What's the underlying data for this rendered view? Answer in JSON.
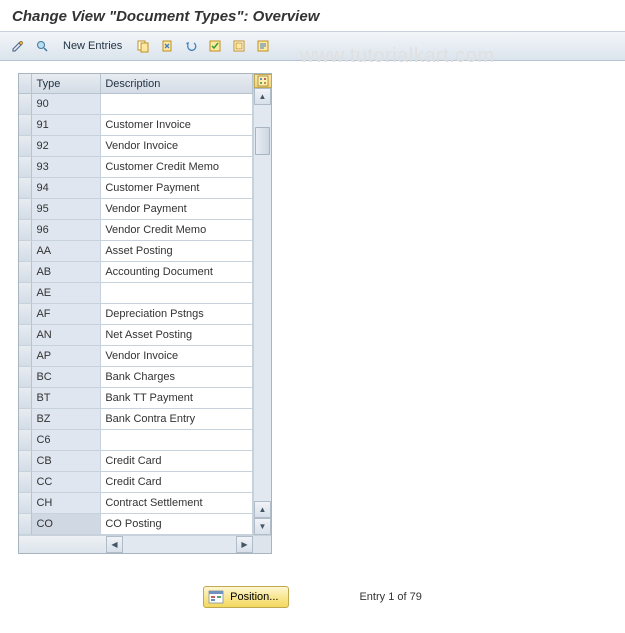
{
  "title": "Change View \"Document Types\": Overview",
  "watermark": "www.tutorialkart.com",
  "toolbar": {
    "new_entries": "New Entries"
  },
  "table": {
    "headers": {
      "type": "Type",
      "description": "Description"
    },
    "rows": [
      {
        "type": "90",
        "desc": ""
      },
      {
        "type": "91",
        "desc": "Customer Invoice"
      },
      {
        "type": "92",
        "desc": "Vendor Invoice"
      },
      {
        "type": "93",
        "desc": "Customer Credit Memo"
      },
      {
        "type": "94",
        "desc": "Customer Payment"
      },
      {
        "type": "95",
        "desc": "Vendor Payment"
      },
      {
        "type": "96",
        "desc": "Vendor Credit Memo"
      },
      {
        "type": "AA",
        "desc": "Asset Posting"
      },
      {
        "type": "AB",
        "desc": "Accounting Document"
      },
      {
        "type": "AE",
        "desc": ""
      },
      {
        "type": "AF",
        "desc": "Depreciation Pstngs"
      },
      {
        "type": "AN",
        "desc": "Net Asset Posting"
      },
      {
        "type": "AP",
        "desc": "Vendor Invoice"
      },
      {
        "type": "BC",
        "desc": "Bank Charges"
      },
      {
        "type": "BT",
        "desc": "Bank TT Payment"
      },
      {
        "type": "BZ",
        "desc": "Bank Contra Entry"
      },
      {
        "type": "C6",
        "desc": ""
      },
      {
        "type": "CB",
        "desc": "Credit Card"
      },
      {
        "type": "CC",
        "desc": "Credit Card"
      },
      {
        "type": "CH",
        "desc": "Contract Settlement"
      },
      {
        "type": "CO",
        "desc": "CO Posting"
      }
    ]
  },
  "footer": {
    "position_label": "Position...",
    "entry_status": "Entry 1 of 79"
  }
}
